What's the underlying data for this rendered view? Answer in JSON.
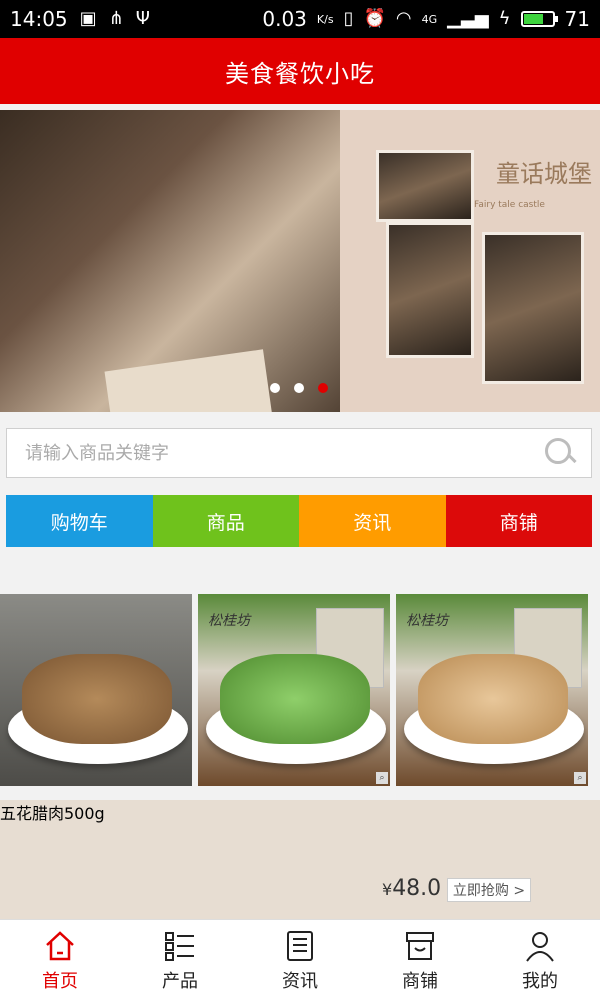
{
  "status_bar": {
    "time": "14:05",
    "speed": "0.03",
    "speed_unit": "K/s",
    "network": "4G",
    "battery": "71"
  },
  "header": {
    "title": "美食餐饮小吃"
  },
  "banner": {
    "castle_text": "童话城堡",
    "castle_subtext": "Fairy tale castle",
    "slide_count": 3,
    "active_slide": 3
  },
  "search": {
    "placeholder": "请输入商品关键字"
  },
  "categories": [
    {
      "label": "购物车",
      "color": "#1a9ce0"
    },
    {
      "label": "商品",
      "color": "#6fc21c"
    },
    {
      "label": "资讯",
      "color": "#ff9c00"
    },
    {
      "label": "商铺",
      "color": "#dc0a0a"
    }
  ],
  "products": [
    {
      "brand": ""
    },
    {
      "brand": "松桂坊"
    },
    {
      "brand": "松桂坊"
    }
  ],
  "promo": {
    "name": "五花腊肉500g",
    "price": "48.0",
    "currency": "¥",
    "button": "立即抢购 >"
  },
  "tabbar": [
    {
      "label": "首页",
      "icon": "home-icon",
      "active": true
    },
    {
      "label": "产品",
      "icon": "grid-list-icon",
      "active": false
    },
    {
      "label": "资讯",
      "icon": "document-icon",
      "active": false
    },
    {
      "label": "商铺",
      "icon": "store-icon",
      "active": false
    },
    {
      "label": "我的",
      "icon": "user-icon",
      "active": false
    }
  ],
  "colors": {
    "brand_red": "#e00000",
    "accent_green": "#3ed43e"
  }
}
